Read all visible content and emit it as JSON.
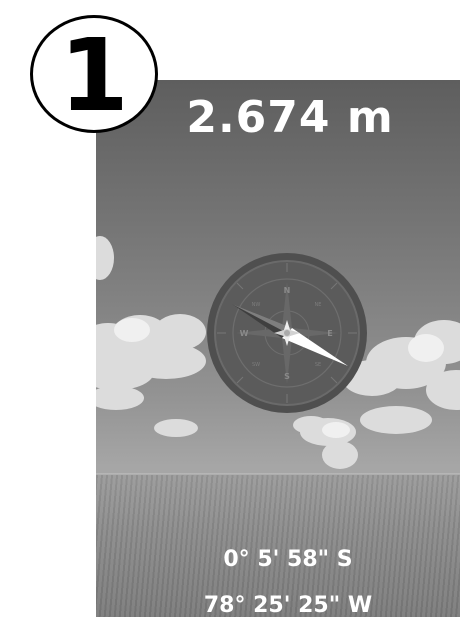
{
  "step_badge": {
    "number": "1"
  },
  "readout": {
    "altitude": "2.674 m",
    "latitude": "0° 5' 58\" S",
    "longitude": "78° 25' 25\" W"
  },
  "compass": {
    "directions": [
      "N",
      "E",
      "S",
      "W"
    ],
    "intercardinals": [
      "NE",
      "SE",
      "SW",
      "NW"
    ]
  },
  "colors": {
    "compass_face": "#5b5b5b",
    "needle_bright": "#ffffff",
    "needle_dark": "#3f3f3f"
  }
}
